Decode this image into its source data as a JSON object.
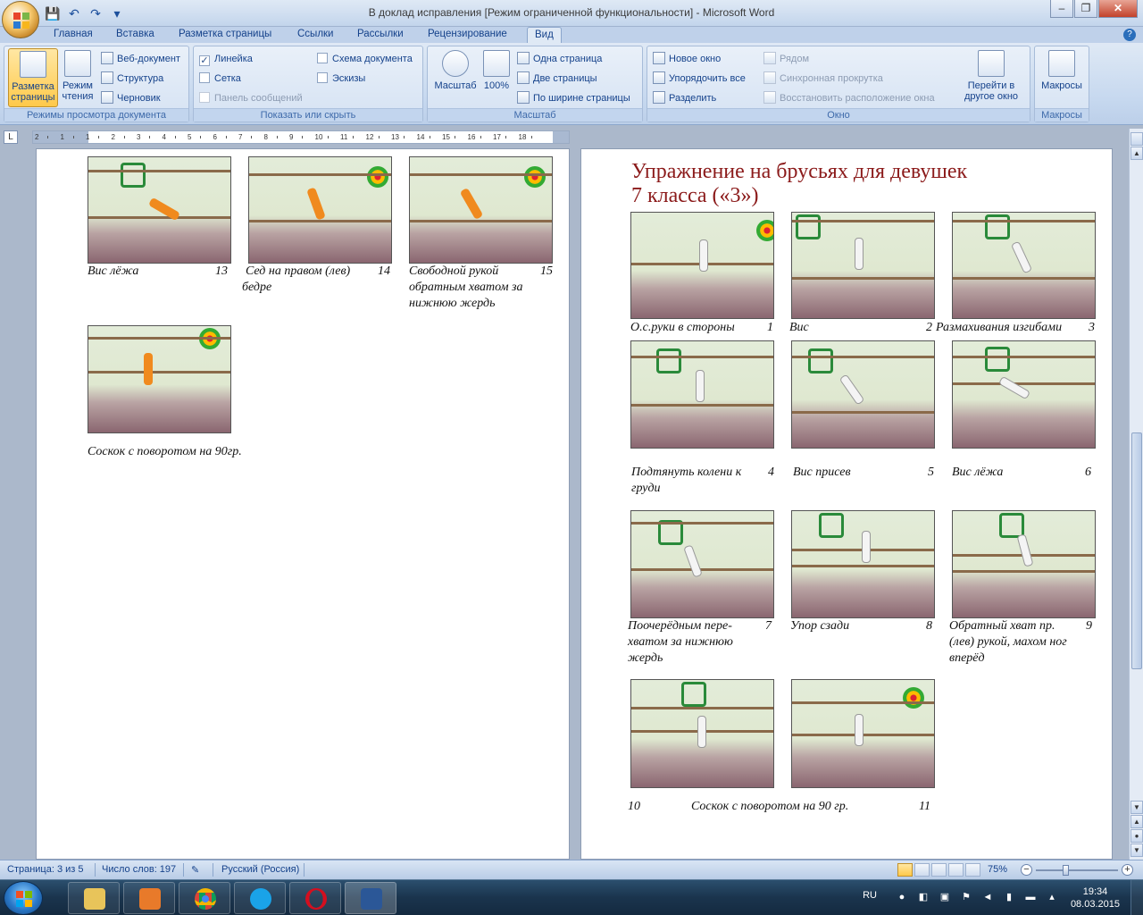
{
  "window": {
    "title": "В доклад исправления [Режим ограниченной функциональности] - Microsoft Word"
  },
  "quick_access": {
    "save_icon": "save-icon",
    "undo_icon": "undo-icon",
    "redo_icon": "redo-icon"
  },
  "tabs": [
    "Главная",
    "Вставка",
    "Разметка страницы",
    "Ссылки",
    "Рассылки",
    "Рецензирование",
    "Вид"
  ],
  "active_tab": "Вид",
  "ribbon": {
    "views": {
      "label": "Режимы просмотра документа",
      "print_layout": "Разметка страницы",
      "full_reading": "Режим чтения",
      "web": "Веб-документ",
      "outline": "Структура",
      "draft": "Черновик"
    },
    "show_hide": {
      "label": "Показать или скрыть",
      "ruler": "Линейка",
      "ruler_checked": "✓",
      "gridlines": "Сетка",
      "message_bar": "Панель сообщений",
      "doc_map": "Схема документа",
      "thumbnails": "Эскизы"
    },
    "zoom": {
      "label": "Масштаб",
      "zoom_btn": "Масштаб",
      "hundred": "100%",
      "one_page": "Одна страница",
      "two_pages": "Две страницы",
      "page_width": "По ширине страницы"
    },
    "window": {
      "label": "Окно",
      "new_window": "Новое окно",
      "arrange_all": "Упорядочить все",
      "split": "Разделить",
      "side_by_side": "Рядом",
      "sync_scroll": "Синхронная прокрутка",
      "reset_position": "Восстановить расположение окна",
      "switch_windows": "Перейти в другое окно"
    },
    "macros": {
      "label": "Макросы",
      "macros_btn": "Макросы"
    }
  },
  "ruler": {
    "numbers": [
      "2",
      "1",
      "1",
      "2",
      "3",
      "4",
      "5",
      "6",
      "7",
      "8",
      "9",
      "10",
      "11",
      "12",
      "13",
      "14",
      "15",
      "16",
      "17",
      "18"
    ]
  },
  "left_page": {
    "captions": [
      {
        "text": "Вис лёжа",
        "num": "13"
      },
      {
        "text": "Сед на правом (лев) бедре",
        "num": "14"
      },
      {
        "text": "Свободной рукой обратным хватом за нижнюю жердь",
        "num": "15"
      }
    ],
    "last_caption": "Соскок с поворотом на 90гр."
  },
  "right_page": {
    "heading_line1": "Упражнение на брусьях для девушек",
    "heading_line2": "7 класса («3»)",
    "captions": [
      {
        "text": "О.с.руки в стороны",
        "num": "1"
      },
      {
        "text": "Вис",
        "num": "2"
      },
      {
        "text": "Размахивания изгибами",
        "num": "3"
      },
      {
        "text": "Подтянуть колени к груди",
        "num": "4"
      },
      {
        "text": "Вис присев",
        "num": "5"
      },
      {
        "text": "Вис лёжа",
        "num": "6"
      },
      {
        "text": "Поочерёдным пере-хватом за нижнюю жердь",
        "num": "7"
      },
      {
        "text": "Упор сзади",
        "num": "8"
      },
      {
        "text": "Обратный хват пр. (лев) рукой, махом ног вперёд",
        "num": "9"
      }
    ],
    "last_row": {
      "num_left": "10",
      "text": "Соскок с поворотом на 90 гр.",
      "num_right": "11"
    }
  },
  "status": {
    "page": "Страница: 3 из 5",
    "words": "Число слов: 197",
    "language": "Русский (Россия)",
    "zoom": "75%",
    "zoom_minus": "−",
    "zoom_plus": "+"
  },
  "taskbar": {
    "apps": [
      "explorer",
      "media-player",
      "chrome",
      "skype",
      "opera",
      "word"
    ],
    "lang": "RU",
    "time": "19:34",
    "date": "08.03.2015"
  }
}
